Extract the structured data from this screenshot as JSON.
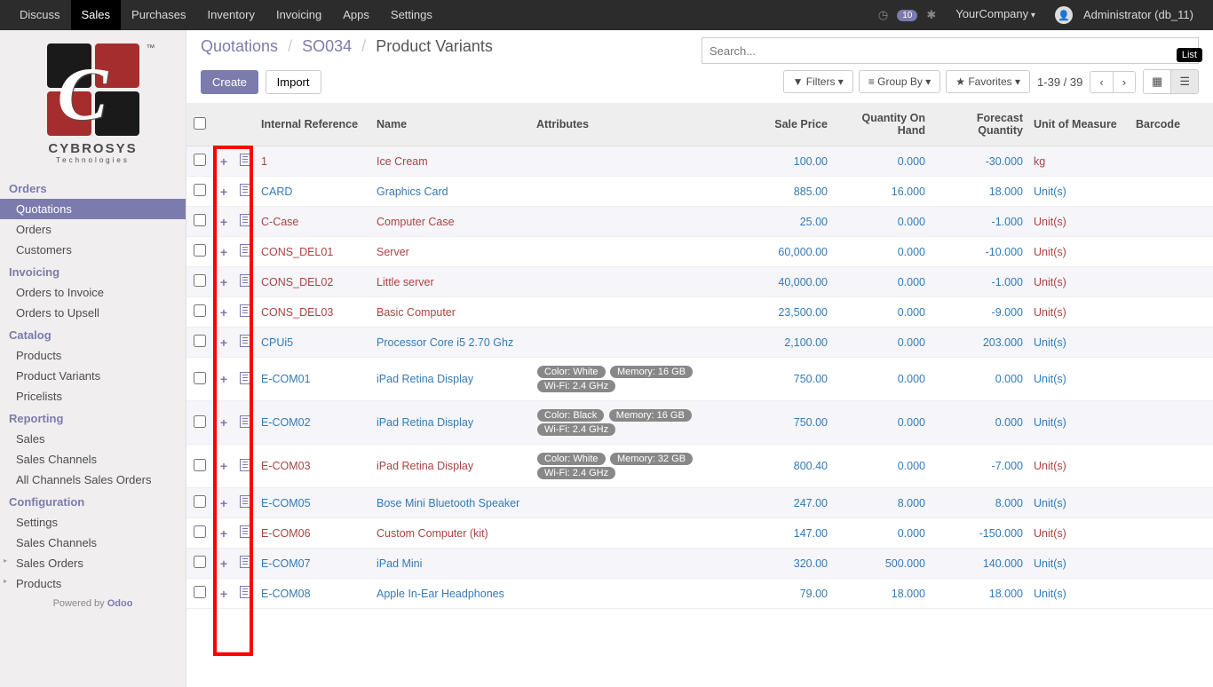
{
  "topnav": {
    "items": [
      "Discuss",
      "Sales",
      "Purchases",
      "Inventory",
      "Invoicing",
      "Apps",
      "Settings"
    ],
    "active_index": 1,
    "msg_count": "10",
    "company": "YourCompany",
    "user": "Administrator (db_11)"
  },
  "sidebar": {
    "logo_text": "CYBROSYS",
    "logo_sub": "Technologies",
    "groups": [
      {
        "title": "Orders",
        "items": [
          "Quotations",
          "Orders",
          "Customers"
        ],
        "active_index": 0
      },
      {
        "title": "Invoicing",
        "items": [
          "Orders to Invoice",
          "Orders to Upsell"
        ]
      },
      {
        "title": "Catalog",
        "items": [
          "Products",
          "Product Variants",
          "Pricelists"
        ]
      },
      {
        "title": "Reporting",
        "items": [
          "Sales",
          "Sales Channels",
          "All Channels Sales Orders"
        ]
      },
      {
        "title": "Configuration",
        "items": [
          "Settings",
          "Sales Channels",
          "Sales Orders",
          "Products"
        ],
        "caret_from": 2
      }
    ],
    "powered_prefix": "Powered by ",
    "powered_brand": "Odoo"
  },
  "breadcrumbs": {
    "a": "Quotations",
    "b": "SO034",
    "c": "Product Variants"
  },
  "buttons": {
    "create": "Create",
    "import": "Import"
  },
  "searchbar": {
    "placeholder": "Search...",
    "filters": "Filters",
    "groupby": "Group By",
    "favorites": "Favorites"
  },
  "pager": {
    "range": "1-39 / 39"
  },
  "tooltip": {
    "list": "List"
  },
  "table": {
    "headers": {
      "ref": "Internal Reference",
      "name": "Name",
      "attr": "Attributes",
      "price": "Sale Price",
      "qoh": "Quantity On Hand",
      "fq": "Forecast Quantity",
      "uom": "Unit of Measure",
      "barcode": "Barcode"
    },
    "rows": [
      {
        "ref": "1",
        "name": "Ice Cream",
        "attrs": [],
        "price": "100.00",
        "qoh": "0.000",
        "fq": "-30.000",
        "uom": "kg",
        "style": "red"
      },
      {
        "ref": "CARD",
        "name": "Graphics Card",
        "attrs": [],
        "price": "885.00",
        "qoh": "16.000",
        "fq": "18.000",
        "uom": "Unit(s)",
        "style": "blue"
      },
      {
        "ref": "C-Case",
        "name": "Computer Case",
        "attrs": [],
        "price": "25.00",
        "qoh": "0.000",
        "fq": "-1.000",
        "uom": "Unit(s)",
        "style": "red"
      },
      {
        "ref": "CONS_DEL01",
        "name": "Server",
        "attrs": [],
        "price": "60,000.00",
        "qoh": "0.000",
        "fq": "-10.000",
        "uom": "Unit(s)",
        "style": "red"
      },
      {
        "ref": "CONS_DEL02",
        "name": "Little server",
        "attrs": [],
        "price": "40,000.00",
        "qoh": "0.000",
        "fq": "-1.000",
        "uom": "Unit(s)",
        "style": "red"
      },
      {
        "ref": "CONS_DEL03",
        "name": "Basic Computer",
        "attrs": [],
        "price": "23,500.00",
        "qoh": "0.000",
        "fq": "-9.000",
        "uom": "Unit(s)",
        "style": "red"
      },
      {
        "ref": "CPUi5",
        "name": "Processor Core i5 2.70 Ghz",
        "attrs": [],
        "price": "2,100.00",
        "qoh": "0.000",
        "fq": "203.000",
        "uom": "Unit(s)",
        "style": "blue"
      },
      {
        "ref": "E-COM01",
        "name": "iPad Retina Display",
        "attrs": [
          "Color: White",
          "Memory: 16 GB",
          "Wi-Fi: 2.4 GHz"
        ],
        "price": "750.00",
        "qoh": "0.000",
        "fq": "0.000",
        "uom": "Unit(s)",
        "style": "blue"
      },
      {
        "ref": "E-COM02",
        "name": "iPad Retina Display",
        "attrs": [
          "Color: Black",
          "Memory: 16 GB",
          "Wi-Fi: 2.4 GHz"
        ],
        "price": "750.00",
        "qoh": "0.000",
        "fq": "0.000",
        "uom": "Unit(s)",
        "style": "blue"
      },
      {
        "ref": "E-COM03",
        "name": "iPad Retina Display",
        "attrs": [
          "Color: White",
          "Memory: 32 GB",
          "Wi-Fi: 2.4 GHz"
        ],
        "price": "800.40",
        "qoh": "0.000",
        "fq": "-7.000",
        "uom": "Unit(s)",
        "style": "red"
      },
      {
        "ref": "E-COM05",
        "name": "Bose Mini Bluetooth Speaker",
        "attrs": [],
        "price": "247.00",
        "qoh": "8.000",
        "fq": "8.000",
        "uom": "Unit(s)",
        "style": "blue"
      },
      {
        "ref": "E-COM06",
        "name": "Custom Computer (kit)",
        "attrs": [],
        "price": "147.00",
        "qoh": "0.000",
        "fq": "-150.000",
        "uom": "Unit(s)",
        "style": "red"
      },
      {
        "ref": "E-COM07",
        "name": "iPad Mini",
        "attrs": [],
        "price": "320.00",
        "qoh": "500.000",
        "fq": "140.000",
        "uom": "Unit(s)",
        "style": "blue"
      },
      {
        "ref": "E-COM08",
        "name": "Apple In-Ear Headphones",
        "attrs": [],
        "price": "79.00",
        "qoh": "18.000",
        "fq": "18.000",
        "uom": "Unit(s)",
        "style": "blue"
      }
    ]
  }
}
